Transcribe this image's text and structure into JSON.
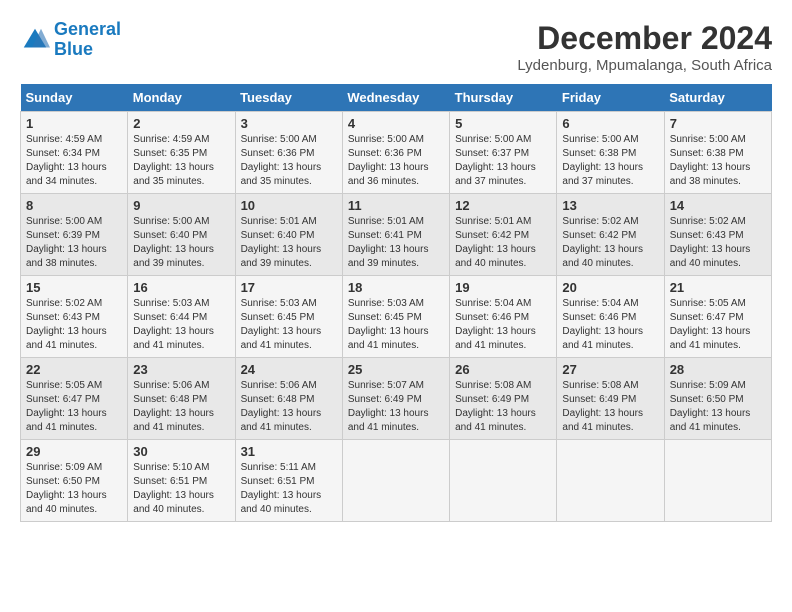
{
  "header": {
    "logo_line1": "General",
    "logo_line2": "Blue",
    "month_title": "December 2024",
    "location": "Lydenburg, Mpumalanga, South Africa"
  },
  "days_of_week": [
    "Sunday",
    "Monday",
    "Tuesday",
    "Wednesday",
    "Thursday",
    "Friday",
    "Saturday"
  ],
  "weeks": [
    [
      {
        "day": 1,
        "sunrise": "4:59 AM",
        "sunset": "6:34 PM",
        "daylight": "13 hours and 34 minutes."
      },
      {
        "day": 2,
        "sunrise": "4:59 AM",
        "sunset": "6:35 PM",
        "daylight": "13 hours and 35 minutes."
      },
      {
        "day": 3,
        "sunrise": "5:00 AM",
        "sunset": "6:36 PM",
        "daylight": "13 hours and 35 minutes."
      },
      {
        "day": 4,
        "sunrise": "5:00 AM",
        "sunset": "6:36 PM",
        "daylight": "13 hours and 36 minutes."
      },
      {
        "day": 5,
        "sunrise": "5:00 AM",
        "sunset": "6:37 PM",
        "daylight": "13 hours and 37 minutes."
      },
      {
        "day": 6,
        "sunrise": "5:00 AM",
        "sunset": "6:38 PM",
        "daylight": "13 hours and 37 minutes."
      },
      {
        "day": 7,
        "sunrise": "5:00 AM",
        "sunset": "6:38 PM",
        "daylight": "13 hours and 38 minutes."
      }
    ],
    [
      {
        "day": 8,
        "sunrise": "5:00 AM",
        "sunset": "6:39 PM",
        "daylight": "13 hours and 38 minutes."
      },
      {
        "day": 9,
        "sunrise": "5:00 AM",
        "sunset": "6:40 PM",
        "daylight": "13 hours and 39 minutes."
      },
      {
        "day": 10,
        "sunrise": "5:01 AM",
        "sunset": "6:40 PM",
        "daylight": "13 hours and 39 minutes."
      },
      {
        "day": 11,
        "sunrise": "5:01 AM",
        "sunset": "6:41 PM",
        "daylight": "13 hours and 39 minutes."
      },
      {
        "day": 12,
        "sunrise": "5:01 AM",
        "sunset": "6:42 PM",
        "daylight": "13 hours and 40 minutes."
      },
      {
        "day": 13,
        "sunrise": "5:02 AM",
        "sunset": "6:42 PM",
        "daylight": "13 hours and 40 minutes."
      },
      {
        "day": 14,
        "sunrise": "5:02 AM",
        "sunset": "6:43 PM",
        "daylight": "13 hours and 40 minutes."
      }
    ],
    [
      {
        "day": 15,
        "sunrise": "5:02 AM",
        "sunset": "6:43 PM",
        "daylight": "13 hours and 41 minutes."
      },
      {
        "day": 16,
        "sunrise": "5:03 AM",
        "sunset": "6:44 PM",
        "daylight": "13 hours and 41 minutes."
      },
      {
        "day": 17,
        "sunrise": "5:03 AM",
        "sunset": "6:45 PM",
        "daylight": "13 hours and 41 minutes."
      },
      {
        "day": 18,
        "sunrise": "5:03 AM",
        "sunset": "6:45 PM",
        "daylight": "13 hours and 41 minutes."
      },
      {
        "day": 19,
        "sunrise": "5:04 AM",
        "sunset": "6:46 PM",
        "daylight": "13 hours and 41 minutes."
      },
      {
        "day": 20,
        "sunrise": "5:04 AM",
        "sunset": "6:46 PM",
        "daylight": "13 hours and 41 minutes."
      },
      {
        "day": 21,
        "sunrise": "5:05 AM",
        "sunset": "6:47 PM",
        "daylight": "13 hours and 41 minutes."
      }
    ],
    [
      {
        "day": 22,
        "sunrise": "5:05 AM",
        "sunset": "6:47 PM",
        "daylight": "13 hours and 41 minutes."
      },
      {
        "day": 23,
        "sunrise": "5:06 AM",
        "sunset": "6:48 PM",
        "daylight": "13 hours and 41 minutes."
      },
      {
        "day": 24,
        "sunrise": "5:06 AM",
        "sunset": "6:48 PM",
        "daylight": "13 hours and 41 minutes."
      },
      {
        "day": 25,
        "sunrise": "5:07 AM",
        "sunset": "6:49 PM",
        "daylight": "13 hours and 41 minutes."
      },
      {
        "day": 26,
        "sunrise": "5:08 AM",
        "sunset": "6:49 PM",
        "daylight": "13 hours and 41 minutes."
      },
      {
        "day": 27,
        "sunrise": "5:08 AM",
        "sunset": "6:49 PM",
        "daylight": "13 hours and 41 minutes."
      },
      {
        "day": 28,
        "sunrise": "5:09 AM",
        "sunset": "6:50 PM",
        "daylight": "13 hours and 41 minutes."
      }
    ],
    [
      {
        "day": 29,
        "sunrise": "5:09 AM",
        "sunset": "6:50 PM",
        "daylight": "13 hours and 40 minutes."
      },
      {
        "day": 30,
        "sunrise": "5:10 AM",
        "sunset": "6:51 PM",
        "daylight": "13 hours and 40 minutes."
      },
      {
        "day": 31,
        "sunrise": "5:11 AM",
        "sunset": "6:51 PM",
        "daylight": "13 hours and 40 minutes."
      },
      null,
      null,
      null,
      null
    ]
  ]
}
